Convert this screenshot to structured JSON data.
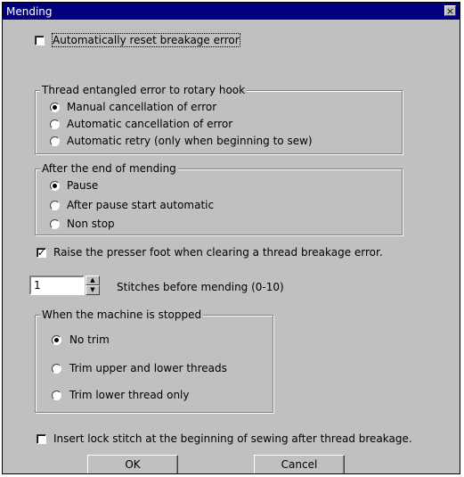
{
  "window": {
    "title": "Mending",
    "close_symbol": "×"
  },
  "auto_reset": {
    "label": "Automatically reset breakage error",
    "checked": false
  },
  "thread_entangled": {
    "title": "Thread entangled error to rotary hook",
    "options": [
      {
        "label": "Manual cancellation of error",
        "selected": true
      },
      {
        "label": "Automatic cancellation of error",
        "selected": false
      },
      {
        "label": "Automatic retry (only when beginning to sew)",
        "selected": false
      }
    ]
  },
  "after_mending": {
    "title": "After the end of mending",
    "options": [
      {
        "label": "Pause",
        "selected": true
      },
      {
        "label": "After pause start automatic",
        "selected": false
      },
      {
        "label": "Non stop",
        "selected": false
      }
    ]
  },
  "raise_presser": {
    "label": "Raise the presser foot when clearing a thread breakage error.",
    "checked": true,
    "mark": "✓"
  },
  "stitches": {
    "value": "1",
    "label": "Stitches before mending  (0-10)",
    "up": "▲",
    "down": "▼"
  },
  "machine_stopped": {
    "title": "When the machine is stopped",
    "options": [
      {
        "label": "No trim",
        "selected": true
      },
      {
        "label": "Trim upper and lower threads",
        "selected": false
      },
      {
        "label": "Trim lower thread only",
        "selected": false
      }
    ]
  },
  "lock_stitch": {
    "label": "Insert lock stitch at the beginning of sewing after thread breakage.",
    "checked": false
  },
  "buttons": {
    "ok": "OK",
    "cancel": "Cancel"
  }
}
